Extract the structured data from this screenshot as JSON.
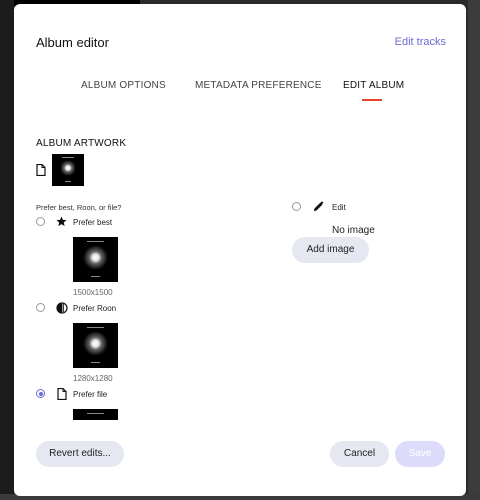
{
  "modal": {
    "title": "Album editor",
    "edit_tracks_link": "Edit tracks"
  },
  "tabs": [
    {
      "label": "ALBUM OPTIONS",
      "active": false
    },
    {
      "label": "METADATA PREFERENCE",
      "active": false
    },
    {
      "label": "EDIT ALBUM",
      "active": true
    }
  ],
  "album_artwork": {
    "heading": "ALBUM ARTWORK",
    "source_icon": "file-icon",
    "prompt": "Prefer best, Roon, or file?",
    "options": [
      {
        "label": "Prefer best",
        "icon": "star-icon",
        "dimensions": "1500x1500",
        "selected": false
      },
      {
        "label": "Prefer Roon",
        "icon": "half-circle-icon",
        "dimensions": "1280x1280",
        "selected": true
      },
      {
        "label": "Prefer file",
        "icon": "file-icon",
        "dimensions": "",
        "selected": true
      }
    ],
    "edit_option": {
      "label": "Edit",
      "icon": "pencil-icon",
      "no_image_text": "No image",
      "add_image_label": "Add image"
    }
  },
  "footer": {
    "revert_label": "Revert edits...",
    "cancel_label": "Cancel",
    "save_label": "Save"
  },
  "colors": {
    "accent": "#6b6bd6",
    "tab_underline": "#e8442c",
    "button_bg": "#e6e8f1",
    "save_disabled_bg": "#dcdcfa"
  }
}
